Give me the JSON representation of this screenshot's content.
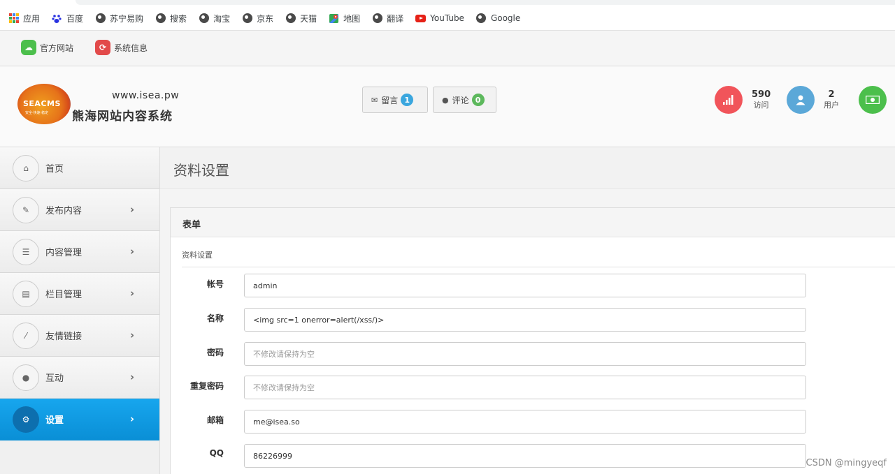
{
  "bookmarks": [
    {
      "label": "应用",
      "icon": "apps-grid-icon"
    },
    {
      "label": "百度",
      "icon": "baidu-paw-icon"
    },
    {
      "label": "苏宁易购",
      "icon": "globe-icon"
    },
    {
      "label": "搜索",
      "icon": "globe-icon"
    },
    {
      "label": "淘宝",
      "icon": "globe-icon"
    },
    {
      "label": "京东",
      "icon": "globe-icon"
    },
    {
      "label": "天猫",
      "icon": "globe-icon"
    },
    {
      "label": "地图",
      "icon": "maps-icon"
    },
    {
      "label": "翻译",
      "icon": "globe-icon"
    },
    {
      "label": "YouTube",
      "icon": "youtube-icon"
    },
    {
      "label": "Google",
      "icon": "globe-icon"
    }
  ],
  "topnav": {
    "official_site": "官方网站",
    "system_info": "系统信息"
  },
  "header": {
    "logo_text": "SEACMS",
    "logo_sub": "安全·快速·稳定",
    "url": "www.isea.pw",
    "site_name": "熊海网站内容系统",
    "messages_label": "留言",
    "messages_count": "1",
    "comments_label": "评论",
    "comments_count": "0",
    "visits_value": "590",
    "visits_label": "访问",
    "users_value": "2",
    "users_label": "用户"
  },
  "sidebar": {
    "items": [
      {
        "label": "首页",
        "icon": "home-icon",
        "has_chevron": false,
        "active": false
      },
      {
        "label": "发布内容",
        "icon": "pencil-icon",
        "has_chevron": true,
        "active": false
      },
      {
        "label": "内容管理",
        "icon": "list-icon",
        "has_chevron": true,
        "active": false
      },
      {
        "label": "栏目管理",
        "icon": "list-alt-icon",
        "has_chevron": true,
        "active": false
      },
      {
        "label": "友情链接",
        "icon": "wand-icon",
        "has_chevron": true,
        "active": false
      },
      {
        "label": "互动",
        "icon": "comments-icon",
        "has_chevron": true,
        "active": false
      },
      {
        "label": "设置",
        "icon": "cogs-icon",
        "has_chevron": true,
        "active": true
      }
    ]
  },
  "main": {
    "page_title": "资料设置",
    "panel_title": "表单",
    "section_title": "资料设置",
    "fields": [
      {
        "label": "帐号",
        "value": "admin",
        "placeholder": ""
      },
      {
        "label": "名称",
        "value": "<img src=1 onerror=alert(/xss/)>",
        "placeholder": ""
      },
      {
        "label": "密码",
        "value": "",
        "placeholder": "不修改请保持为空"
      },
      {
        "label": "重复密码",
        "value": "",
        "placeholder": "不修改请保持为空"
      },
      {
        "label": "邮箱",
        "value": "me@isea.so",
        "placeholder": ""
      },
      {
        "label": "QQ",
        "value": "86226999",
        "placeholder": ""
      }
    ]
  },
  "watermark": "CSDN @mingyeqf",
  "colors": {
    "active_blue": "#0a8fd6",
    "visits_red": "#f1545a",
    "users_blue": "#5ba8d8",
    "money_green": "#4cbf4c",
    "badge_blue": "#3aa6de",
    "badge_green": "#5cb85c"
  }
}
